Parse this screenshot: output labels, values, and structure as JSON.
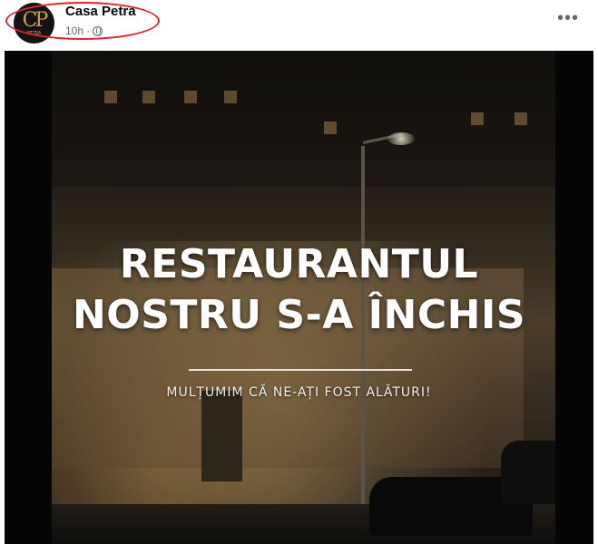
{
  "post": {
    "author": "Casa Petra",
    "time": "10h",
    "separator": "·",
    "privacy_icon": "globe-icon",
    "more_label": "•••",
    "avatar": {
      "monogram": "CP",
      "caption": "PETRA"
    }
  },
  "image": {
    "headline_line1": "RESTAURANTUL",
    "headline_line2": "NOSTRU S-A ÎNCHIS",
    "subline": "MULȚUMIM CĂ NE-AȚI FOST ALĂTURI!"
  },
  "colors": {
    "annotation_circle": "#e0242e",
    "author_text": "#050505",
    "meta_text": "#65676b"
  }
}
